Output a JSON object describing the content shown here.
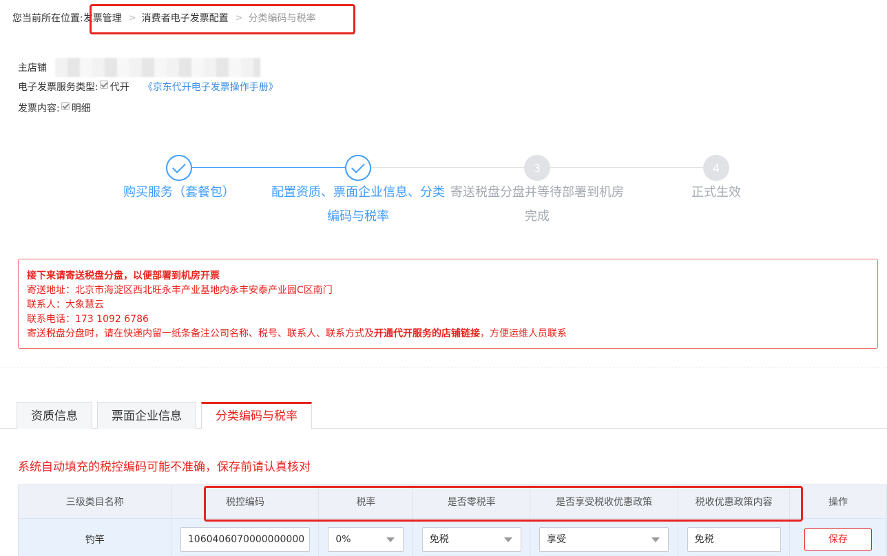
{
  "breadcrumb": {
    "prefix": "您当前所在位置:",
    "items": [
      "发票管理",
      "消费者电子发票配置",
      "分类编码与税率"
    ]
  },
  "shop": {
    "label": "主店铺"
  },
  "service_type": {
    "label": "电子发票服务类型:",
    "option": "代开",
    "manual_link": "《京东代开电子发票操作手册》"
  },
  "invoice_content": {
    "label": "发票内容:",
    "option": "明细"
  },
  "steps": [
    {
      "line1": "购买服务（套餐包）",
      "line2": "",
      "state": "done",
      "number": ""
    },
    {
      "line1": "配置资质、票面企业信息、分类",
      "line2": "编码与税率",
      "state": "done",
      "number": ""
    },
    {
      "line1": "寄送税盘分盘并等待部署到机房",
      "line2": "完成",
      "state": "todo",
      "number": "3"
    },
    {
      "line1": "正式生效",
      "line2": "",
      "state": "todo",
      "number": "4"
    }
  ],
  "notice": {
    "title": "接下来请寄送税盘分盘，以便部署到机房开票",
    "address": "寄送地址：北京市海淀区西北旺永丰产业基地内永丰安泰产业园C区南门",
    "contact": "联系人：大象慧云",
    "phone": "联系电话：173 1092 6786",
    "tip_before": "寄送税盘分盘时，请在快递内留一纸条备注公司名称、税号、联系人、联系方式及",
    "tip_bold": "开通代开服务的店铺链接",
    "tip_after": "，方便运维人员联系"
  },
  "tabs": [
    {
      "label": "资质信息",
      "active": false
    },
    {
      "label": "票面企业信息",
      "active": false
    },
    {
      "label": "分类编码与税率",
      "active": true
    }
  ],
  "warning": "系统自动填充的税控编码可能不准确，保存前请认真核对",
  "table": {
    "headers": [
      "三级类目名称",
      "税控编码",
      "税率",
      "是否零税率",
      "是否享受税收优惠政策",
      "税收优惠政策内容",
      "操作"
    ],
    "rows": [
      {
        "category": "钓竿",
        "code": "1060406070000000000",
        "rate": "0%",
        "zero_rate": "免税",
        "enjoy": "享受",
        "policy": "免税",
        "action": "保存"
      }
    ]
  },
  "colors": {
    "accent": "#e8231d",
    "link": "#3a8ee6",
    "step_done": "#409eff",
    "step_todo": "#e0e2e6"
  }
}
